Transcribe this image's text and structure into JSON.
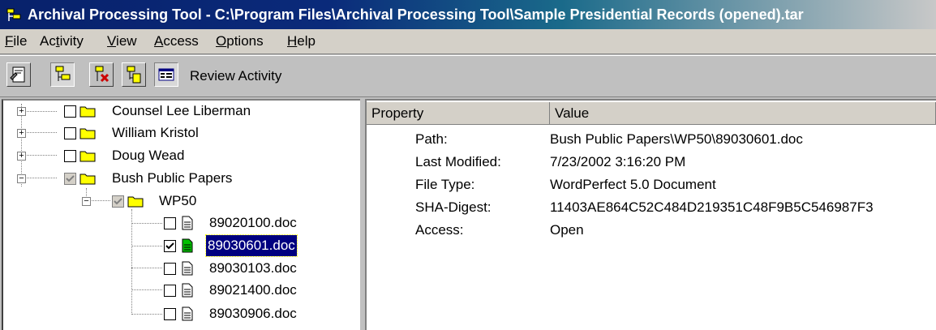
{
  "window": {
    "title": "Archival Processing Tool - C:\\Program Files\\Archival Processing Tool\\Sample Presidential Records (opened).tar"
  },
  "menu": {
    "items": [
      {
        "label": "File",
        "key": "F"
      },
      {
        "label": "Activity",
        "key": "t"
      },
      {
        "label": "View",
        "key": "V"
      },
      {
        "label": "Access",
        "key": "A"
      },
      {
        "label": "Options",
        "key": "O"
      },
      {
        "label": "Help",
        "key": "H"
      }
    ]
  },
  "toolbar": {
    "activity_label": "Review Activity",
    "icons": [
      "properties-icon",
      "review-icon",
      "restricted-icon",
      "document-icon",
      "details-icon"
    ]
  },
  "tree": {
    "nodes": [
      {
        "label": "Counsel Lee Liberman",
        "type": "folder",
        "checked": false,
        "expanded": false
      },
      {
        "label": "William Kristol",
        "type": "folder",
        "checked": false,
        "expanded": false
      },
      {
        "label": "Doug Wead",
        "type": "folder",
        "checked": false,
        "expanded": false
      },
      {
        "label": "Bush Public Papers",
        "type": "folder",
        "checked": "partial",
        "expanded": true
      },
      {
        "label": "WP50",
        "type": "folder",
        "checked": "partial",
        "expanded": true
      },
      {
        "label": "89020100.doc",
        "type": "file",
        "checked": false
      },
      {
        "label": "89030601.doc",
        "type": "file",
        "checked": true,
        "selected": true
      },
      {
        "label": "89030103.doc",
        "type": "file",
        "checked": false
      },
      {
        "label": "89021400.doc",
        "type": "file",
        "checked": false
      },
      {
        "label": "89030906.doc",
        "type": "file",
        "checked": false
      }
    ]
  },
  "list": {
    "col_property": "Property",
    "col_value": "Value",
    "rows": [
      {
        "k": "Path:",
        "v": "Bush Public Papers\\WP50\\89030601.doc"
      },
      {
        "k": "Last Modified:",
        "v": "7/23/2002 3:16:20 PM"
      },
      {
        "k": "File Type:",
        "v": "WordPerfect 5.0 Document"
      },
      {
        "k": "SHA-Digest:",
        "v": "11403AE864C52C484D219351C48F9B5C546987F3"
      },
      {
        "k": "Access:",
        "v": "Open"
      }
    ]
  },
  "colors": {
    "title_start": "#08216b",
    "selection": "#000080",
    "folder": "#ffff00",
    "checked_file": "#00a000"
  }
}
